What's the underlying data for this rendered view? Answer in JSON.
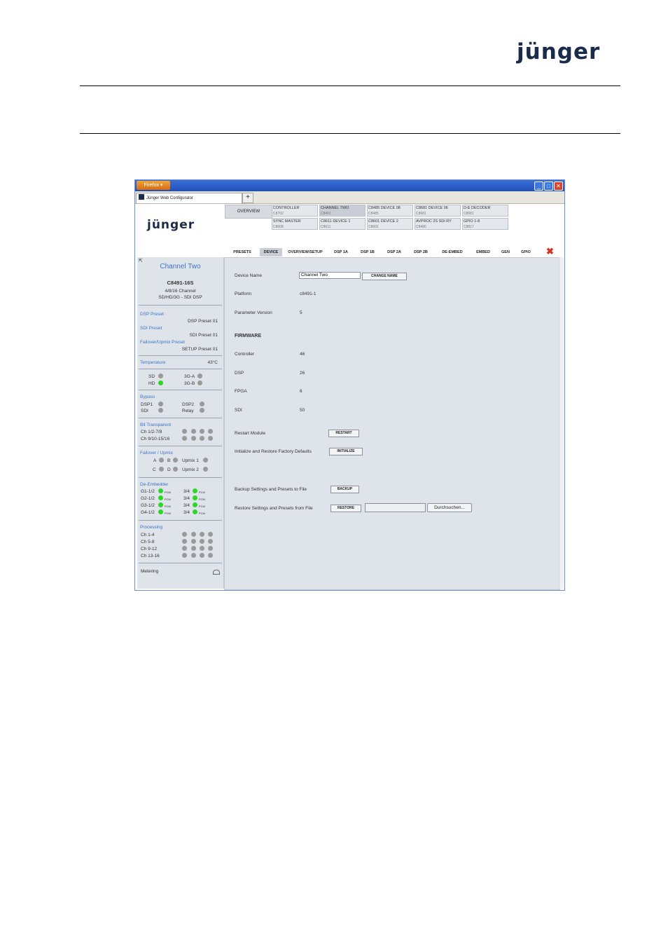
{
  "header": {
    "logo_text": "jünger"
  },
  "browser": {
    "app_button": "Firefox",
    "tab_title": "Jünger Web Configurator",
    "new_tab_symbol": "+",
    "controls": [
      "_",
      "□",
      "✕"
    ]
  },
  "web": {
    "logo_text": "jünger",
    "overview_label": "OVERVIEW",
    "devices": [
      {
        "name": "CONTROLLER",
        "code": "C8702",
        "selected": false
      },
      {
        "name": "CHANNEL TWO",
        "code": "C8491",
        "selected": true
      },
      {
        "name": "C8485 DEVICE 08",
        "code": "C8485",
        "selected": false
      },
      {
        "name": "C8681 DEVICE 06",
        "code": "C8681",
        "selected": false
      },
      {
        "name": "D-E DECODER",
        "code": "C8681",
        "selected": false
      },
      {
        "name": "SYNC MASTER",
        "code": "C8608",
        "selected": false
      },
      {
        "name": "C8611 DEVICE 1",
        "code": "C8611",
        "selected": false
      },
      {
        "name": "C8601 DEVICE 2",
        "code": "C8601",
        "selected": false
      },
      {
        "name": "AVPROC 2S SDI RY",
        "code": "C8486",
        "selected": false
      },
      {
        "name": "GPIO 1-8",
        "code": "C8817",
        "selected": false
      }
    ],
    "tabs": [
      "PRESETS",
      "DEVICE",
      "OVERVIEW/SETUP",
      "DSP 1A",
      "DSP 1B",
      "DSP 2A",
      "DSP 2B",
      "DE-EMBED",
      "EMBED",
      "GEN",
      "GPIO"
    ],
    "active_tab": "DEVICE",
    "close_symbol": "✖"
  },
  "left": {
    "resize_icon": "⇱",
    "device_title": "Channel Two",
    "model": "C8491-16S",
    "desc1": "4/8/16 Channel",
    "desc2": "SD/HD/3G - SDI DSP",
    "dsp_preset_label": "DSP Preset",
    "dsp_preset_value": "DSP Preset 01",
    "sdi_preset_label": "SDI Preset",
    "sdi_preset_value": "SDI Preset 01",
    "failover_preset_label": "Failover/Upmix Preset",
    "failover_preset_value": "SETUP Preset 01",
    "temperature_label": "Temperature",
    "temperature_value": "43°C",
    "sd": "SD",
    "hd": "HD",
    "g3a": "3G-A",
    "g3b": "3G-B",
    "bypass_label": "Bypass",
    "dsp1": "DSP1",
    "dsp2": "DSP2",
    "sdi": "SDI",
    "relay": "Relay",
    "bit_label": "Bit Transparent",
    "bit_row1": "Ch 1/2-7/8",
    "bit_row2": "Ch 9/10-15/16",
    "failover_label": "Failover / Upmix",
    "fa": "A",
    "fb": "B",
    "fc": "C",
    "fd": "D",
    "up1": "Upmix 1",
    "up2": "Upmix 2",
    "deembed_label": "De-Embedder",
    "deembed_rows": [
      "G1-1/2",
      "G2-1/2",
      "G3-1/2",
      "G4-1/2"
    ],
    "deembed_pair": "3/4",
    "pcm": "PCM",
    "processing_label": "Processing",
    "processing_rows": [
      "Ch 1-4",
      "Ch 5-8",
      "Ch 9-12",
      "Ch 13-16"
    ],
    "metering_label": "Metering"
  },
  "main": {
    "device_name_label": "Device Name",
    "device_name_value": "Channel Two",
    "change_name_button": "CHANGE NAME",
    "platform_label": "Platform",
    "platform_value": "c8491-1",
    "param_label": "Parameter Version",
    "param_value": "5",
    "firmware_heading": "FIRMWARE",
    "controller_label": "Controller",
    "controller_value": "46",
    "dsp_label": "DSP",
    "dsp_value": "26",
    "fpga_label": "FPGA",
    "fpga_value": "6",
    "sdi_label": "SDI",
    "sdi_value": "50",
    "restart_label": "Restart Module",
    "restart_button": "RESTART",
    "init_label": "Initialize and Restore Factory Defaults",
    "init_button": "INITIALIZE",
    "backup_label": "Backup Settings and Presets to File",
    "backup_button": "BACKUP",
    "restore_label": "Restore Settings and Presets from File",
    "restore_button": "RESTORE",
    "file_value": "",
    "browse_button": "Durchsuchen..."
  }
}
